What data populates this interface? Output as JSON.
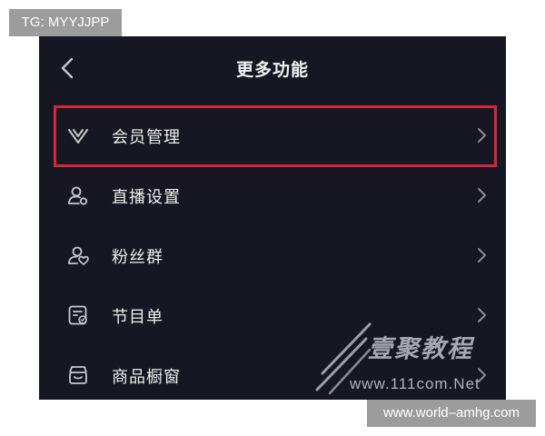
{
  "overlay": {
    "top_tag": "TG: MYYJJPP",
    "bottom_tag": "www.world–amhg.com"
  },
  "header": {
    "title": "更多功能",
    "back_icon": "chevron-left-icon"
  },
  "menu": {
    "items": [
      {
        "label": "会员管理",
        "icon": "vip-v-icon",
        "highlighted": true
      },
      {
        "label": "直播设置",
        "icon": "user-settings-icon"
      },
      {
        "label": "粉丝群",
        "icon": "fan-group-icon"
      },
      {
        "label": "节目单",
        "icon": "program-list-icon"
      },
      {
        "label": "商品橱窗",
        "icon": "shop-window-icon"
      }
    ],
    "chevron_icon": "chevron-right-icon"
  },
  "watermark": {
    "brand": "壹聚教程",
    "url": "www.111com.Net"
  },
  "colors": {
    "background": "#161722",
    "highlight": "#d2283a",
    "text": "#eeeeee",
    "icon": "#c8c8cc"
  }
}
